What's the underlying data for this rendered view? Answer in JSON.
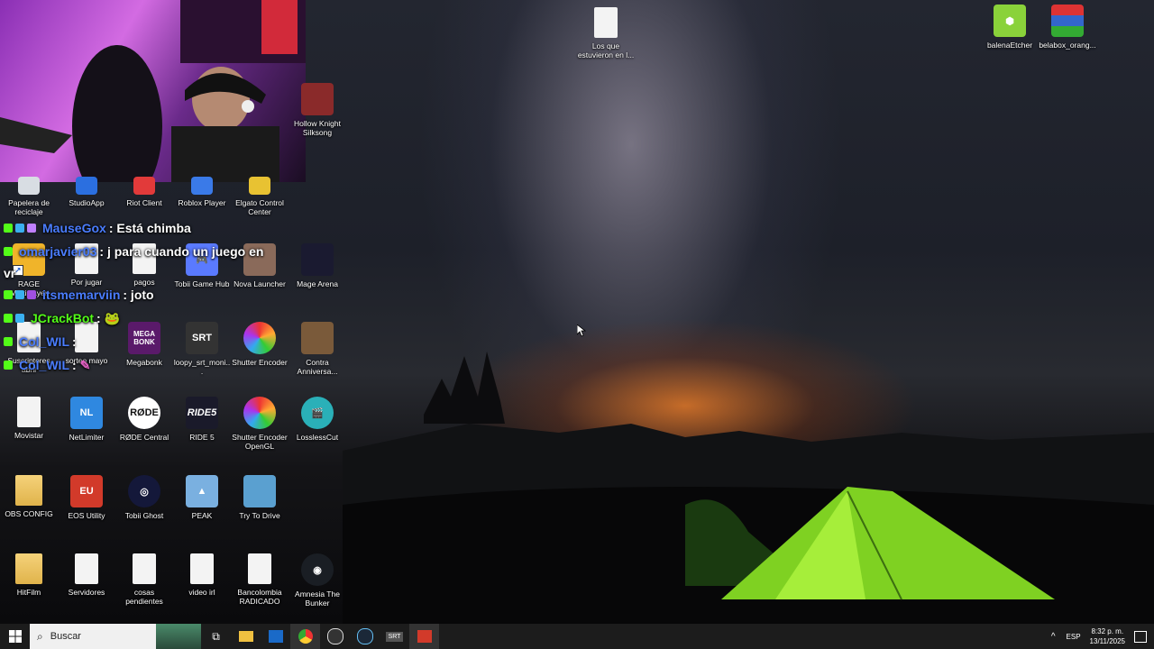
{
  "desktop": {
    "icons": {
      "recycle": "Papelera de reciclaje",
      "studioapp": "StudioApp",
      "riot": "Riot Client",
      "roblox": "Roblox Player",
      "elgato": "Elgato Control Center",
      "hollow": "Hollow Knight Silksong",
      "losque": "Los que estuvieron en l...",
      "balena": "balenaEtcher",
      "belabox": "belabox_orang...",
      "rage": "RAGE Multiplayer",
      "porjugar": "Por jugar",
      "pagos": "pagos",
      "tobiihub": "Tobii Game Hub",
      "nova": "Nova Launcher",
      "mage": "Mage Arena",
      "suscriptores": "Suscriptores abril",
      "sorteo": "sorteo mayo",
      "megabonk": "Megabonk",
      "loopy": "loopy_srt_moni...",
      "shutter": "Shutter Encoder",
      "contra": "Contra Anniversa...",
      "movistar": "Movistar",
      "netlimiter": "NetLimiter",
      "rode": "RØDE Central",
      "ride5": "RIDE 5",
      "shutteropengl": "Shutter Encoder OpenGL",
      "losslesscut": "LosslessCut",
      "obsconfig": "OBS CONFIG",
      "eos": "EOS Utility",
      "tobiighost": "Tobii Ghost",
      "peak": "PEAK",
      "trytodrive": "Try To Drive",
      "hitfilm": "HitFilm",
      "servidores": "Servidores",
      "cosas": "cosas pendientes",
      "videoirl": "video irl",
      "bancolombia": "Bancolombia RADICADO",
      "amnesia": "Amnesia The Bunker"
    }
  },
  "chat": {
    "messages": [
      {
        "user": "MauseGox",
        "text": ": Está chimba"
      },
      {
        "user": "omarjavier03",
        "text": ": j para cuando un juego en"
      },
      {
        "user": "vr",
        "text": ""
      },
      {
        "user": "itsmemarviin",
        "text": ": joto"
      },
      {
        "user": "JCrackBot",
        "text": ":"
      },
      {
        "user": "Col_WIL",
        "text": ":"
      },
      {
        "user": "Col_WIL",
        "text": ":"
      }
    ]
  },
  "taskbar": {
    "search_placeholder": "Buscar",
    "language": "ESP",
    "time": "8:32 p. m.",
    "date": "13/11/2025"
  },
  "colors": {
    "taskbar": "#1c1c1c",
    "chat_user_blue": "#4a7dff",
    "chat_badge_green": "#53fc18"
  }
}
